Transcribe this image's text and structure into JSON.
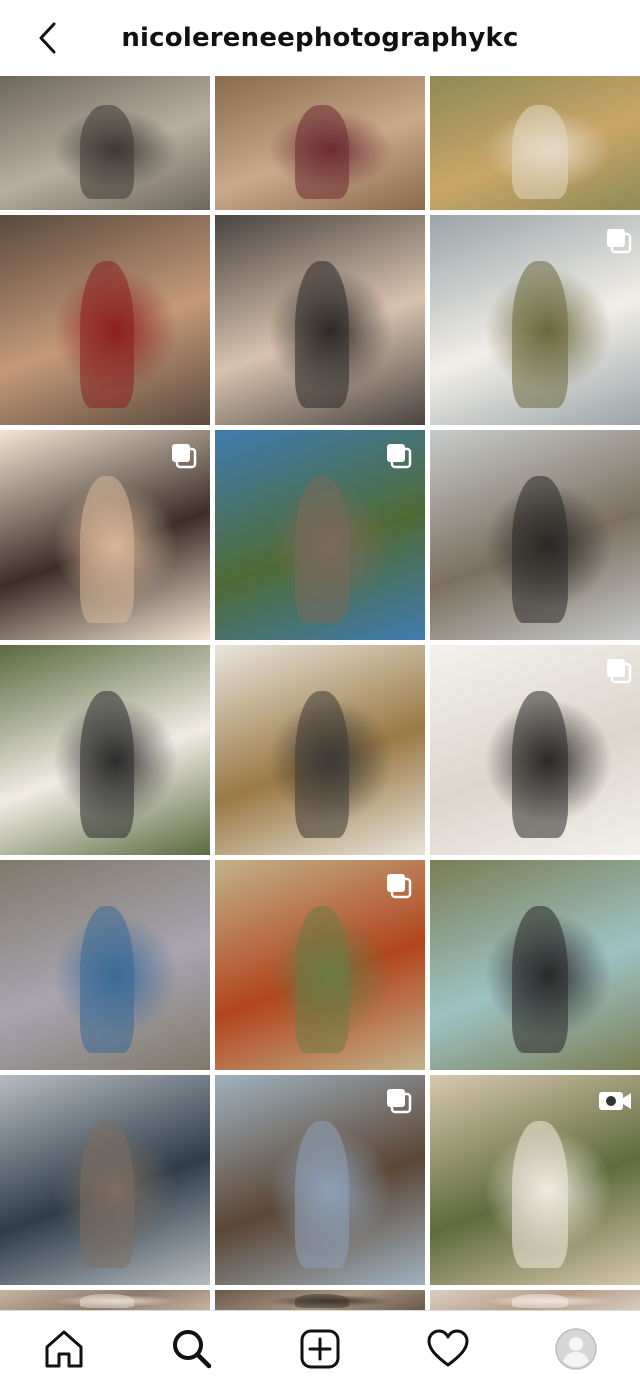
{
  "header": {
    "title": "nicolereneephotographykc",
    "back_icon": "chevron-left-icon"
  },
  "grid": {
    "tiles": [
      {
        "subject": "woman posing with arms up in a plaza",
        "colors": [
          "#6e675c",
          "#b7ae9e",
          "#3e3a34"
        ],
        "badge": ""
      },
      {
        "subject": "woman in floral dress among grasses",
        "colors": [
          "#8a6a4d",
          "#c9a98a",
          "#6d2c33"
        ],
        "badge": ""
      },
      {
        "subject": "mother holding baby in field",
        "colors": [
          "#8d8a57",
          "#c9a667",
          "#e4d9c5"
        ],
        "badge": ""
      },
      {
        "subject": "family portrait with toddler",
        "colors": [
          "#5b4a3d",
          "#c49a7a",
          "#8b2020"
        ],
        "badge": ""
      },
      {
        "subject": "parents kissing baby",
        "colors": [
          "#4a4440",
          "#d8c2ad",
          "#2d2a28"
        ],
        "badge": ""
      },
      {
        "subject": "bride on lakeside hill",
        "colors": [
          "#9aa4a8",
          "#f1eee8",
          "#6b6a3e"
        ],
        "badge": "multiple-images-icon"
      },
      {
        "subject": "couple kissing on dock at sunset",
        "colors": [
          "#f1e4d0",
          "#3b2e28",
          "#d9b89a"
        ],
        "badge": "multiple-images-icon"
      },
      {
        "subject": "wedding couple on pier by lake",
        "colors": [
          "#3f7bb0",
          "#4e6b36",
          "#7a6a5a"
        ],
        "badge": "multiple-images-icon"
      },
      {
        "subject": "wedding couple walking on road",
        "colors": [
          "#c8cbcb",
          "#7b7060",
          "#2c2a28"
        ],
        "badge": ""
      },
      {
        "subject": "woman lying among flowers",
        "colors": [
          "#5b6a3f",
          "#f0ece4",
          "#2c2c2c"
        ],
        "badge": ""
      },
      {
        "subject": "woman in golden light field",
        "colors": [
          "#e9e4dc",
          "#9a7a45",
          "#3e3a36"
        ],
        "badge": ""
      },
      {
        "subject": "bride reaching hand",
        "colors": [
          "#f3f1ee",
          "#dcd6cc",
          "#2c2a28"
        ],
        "badge": "multiple-images-icon"
      },
      {
        "subject": "woman in purple top in meadow",
        "colors": [
          "#7e7a6a",
          "#a9a4b0",
          "#3b6a96"
        ],
        "badge": ""
      },
      {
        "subject": "mother in orange dress with child",
        "colors": [
          "#c2b28a",
          "#b2451e",
          "#6b7a43"
        ],
        "badge": "multiple-images-icon"
      },
      {
        "subject": "woman lying in tall grass",
        "colors": [
          "#7a7e54",
          "#9ec3c4",
          "#2a2a2a"
        ],
        "badge": ""
      },
      {
        "subject": "couple on pier over lake",
        "colors": [
          "#b6bcc0",
          "#2f3d4a",
          "#7b6d60"
        ],
        "badge": ""
      },
      {
        "subject": "woman in blue dress by driftwood",
        "colors": [
          "#9fb2c0",
          "#5b4634",
          "#8ea0b8"
        ],
        "badge": "multiple-images-icon"
      },
      {
        "subject": "wedding couple close embrace",
        "colors": [
          "#d7c8ad",
          "#5f6b3e",
          "#f1ebe0"
        ],
        "badge": "video-camera-icon"
      },
      {
        "subject": "partial image row",
        "colors": [
          "#c9b3a0",
          "#8a7a6a",
          "#e6dcd0"
        ],
        "badge": ""
      },
      {
        "subject": "partial image row",
        "colors": [
          "#6b5a4a",
          "#a69682",
          "#3e342a"
        ],
        "badge": ""
      },
      {
        "subject": "partial image row",
        "colors": [
          "#d9cfc3",
          "#b69c86",
          "#efe8de"
        ],
        "badge": ""
      }
    ]
  },
  "bottom_nav": {
    "items": [
      {
        "icon": "home-icon"
      },
      {
        "icon": "search-icon"
      },
      {
        "icon": "add-post-icon"
      },
      {
        "icon": "heart-icon"
      },
      {
        "icon": "profile-avatar-icon"
      }
    ]
  }
}
